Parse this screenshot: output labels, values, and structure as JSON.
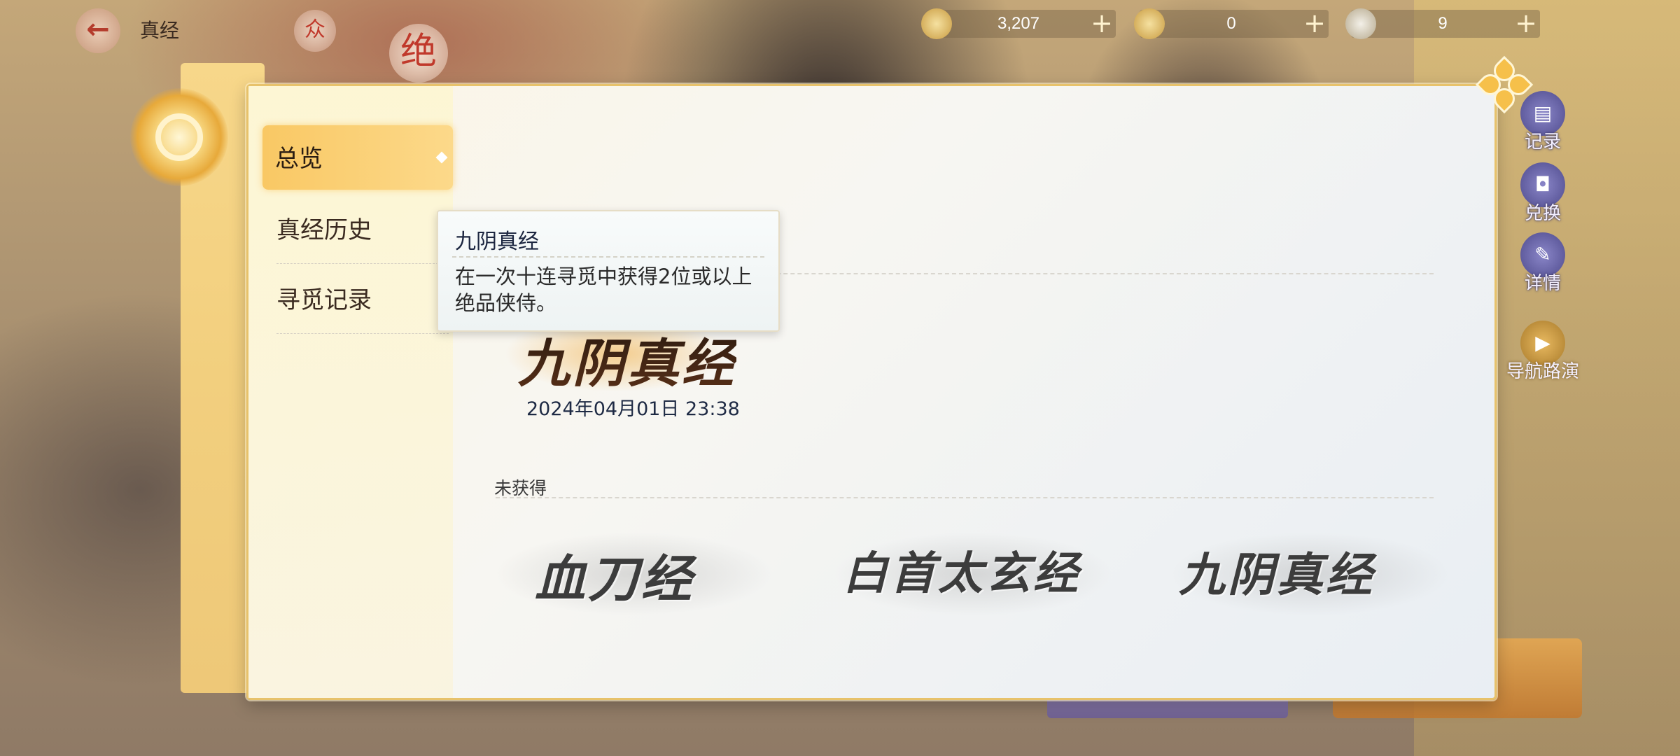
{
  "header": {
    "title": "真经",
    "seal1": "众",
    "seal2": "绝"
  },
  "currencies": [
    {
      "name": "silver",
      "value": "3,207"
    },
    {
      "name": "gold",
      "value": "0"
    },
    {
      "name": "token",
      "value": "9"
    }
  ],
  "side_buttons": [
    {
      "label": "记录",
      "icon": "book-icon"
    },
    {
      "label": "兑换",
      "icon": "exchange-icon"
    },
    {
      "label": "详情",
      "icon": "scroll-icon"
    },
    {
      "label": "导航路演",
      "icon": "video-icon"
    }
  ],
  "sidebar": {
    "items": [
      {
        "label": "总览",
        "active": true
      },
      {
        "label": "真经历史",
        "active": false
      },
      {
        "label": "寻觅记录",
        "active": false
      }
    ]
  },
  "owned": {
    "title": "九阴真经",
    "date": "2024年04月01日 23:38"
  },
  "unowned": {
    "label": "未获得",
    "items": [
      "血刀经",
      "白首太玄经",
      "九阴真经"
    ]
  },
  "tooltip": {
    "title": "九阴真经",
    "description": "在一次十连寻觅中获得2位或以上绝品侠侍。"
  },
  "colors": {
    "accent_gold": "#f6c04a",
    "dialog_border": "#e7c26b",
    "text_dark": "#1e2a44"
  }
}
